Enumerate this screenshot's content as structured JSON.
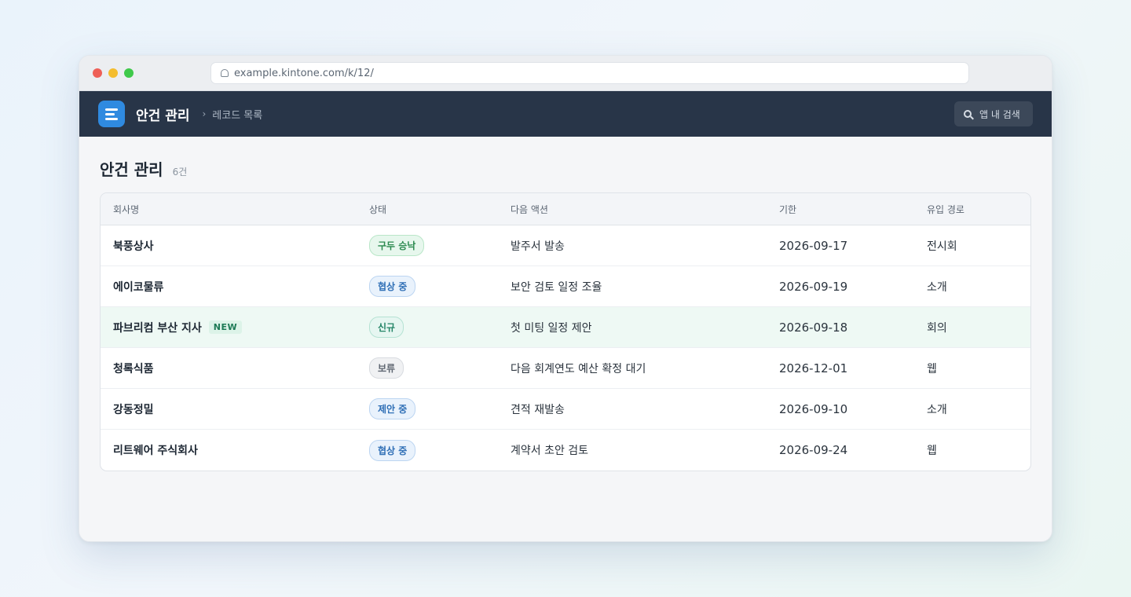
{
  "browser": {
    "url": "example.kintone.com/k/12/"
  },
  "app": {
    "title": "안건 관리",
    "breadcrumb_sep": "›",
    "breadcrumb": "레코드 목록",
    "search_label": "앱 내 검색"
  },
  "page": {
    "title": "안건 관리",
    "count": "6건"
  },
  "table": {
    "headers": {
      "company": "회사명",
      "status": "상태",
      "next_action": "다음 액션",
      "due": "기한",
      "source": "유입 경로"
    },
    "rows": [
      {
        "company": "북풍상사",
        "badge": "",
        "status": "구두 승낙",
        "status_color": "#2b8a4f",
        "next_action": "발주서 발송",
        "due": "2026-09-17",
        "source": "전시회"
      },
      {
        "company": "에이코물류",
        "badge": "",
        "status": "협상 중",
        "status_color": "#2f6fb6",
        "next_action": "보안 검토 일정 조율",
        "due": "2026-09-19",
        "source": "소개"
      },
      {
        "company": "파브리컴 부산 지사",
        "badge": "NEW",
        "status": "신규",
        "status_color": "#238466",
        "next_action": "첫 미팅 일정 제안",
        "due": "2026-09-18",
        "source": "회의"
      },
      {
        "company": "청록식품",
        "badge": "",
        "status": "보류",
        "status_color": "#5f6772",
        "next_action": "다음 회계연도 예산 확정 대기",
        "due": "2026-12-01",
        "source": "웹"
      },
      {
        "company": "강동정밀",
        "badge": "",
        "status": "제안 중",
        "status_color": "#2f6fb6",
        "next_action": "견적 재발송",
        "due": "2026-09-10",
        "source": "소개"
      },
      {
        "company": "리트웨어 주식회사",
        "badge": "",
        "status": "협상 중",
        "status_color": "#2f6fb6",
        "next_action": "계약서 초안 검토",
        "due": "2026-09-24",
        "source": "웹"
      }
    ]
  }
}
